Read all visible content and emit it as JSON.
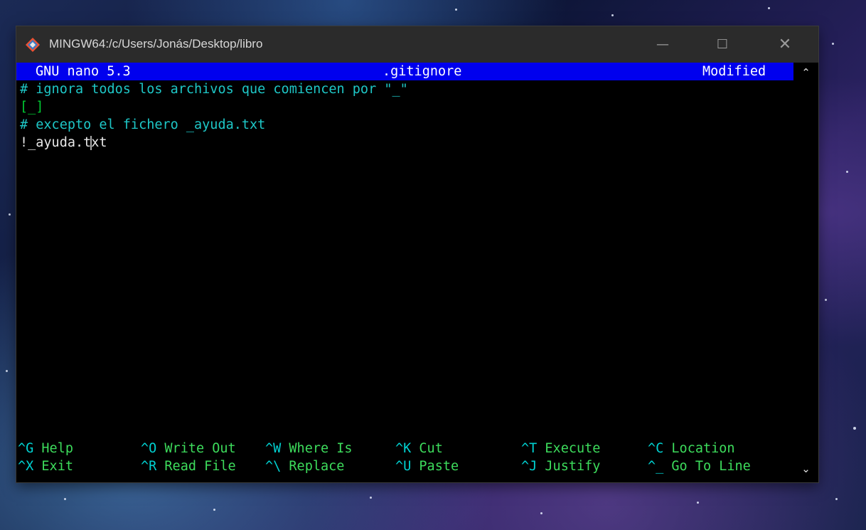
{
  "window": {
    "title": "MINGW64:/c/Users/Jonás/Desktop/libro",
    "minimize_icon": "—",
    "maximize_icon": "☐",
    "close_icon": "✕",
    "app_icon": "git-icon"
  },
  "nano": {
    "version": "GNU nano 5.3",
    "filename": ".gitignore",
    "status": "Modified"
  },
  "lines": [
    "# ignora todos los archivos que comiencen por \"_\"",
    "[_]",
    "# excepto el fichero _ayuda.txt",
    "!_ayuda.txt"
  ],
  "line4_before_cursor": "!_ayuda.t",
  "line4_after_cursor": "xt",
  "shortcuts": {
    "row1": [
      {
        "key": "^G",
        "label": "Help"
      },
      {
        "key": "^O",
        "label": "Write Out"
      },
      {
        "key": "^W",
        "label": "Where Is"
      },
      {
        "key": "^K",
        "label": "Cut"
      },
      {
        "key": "^T",
        "label": "Execute"
      },
      {
        "key": "^C",
        "label": "Location"
      }
    ],
    "row2": [
      {
        "key": "^X",
        "label": "Exit"
      },
      {
        "key": "^R",
        "label": "Read File"
      },
      {
        "key": "^\\",
        "label": "Replace"
      },
      {
        "key": "^U",
        "label": "Paste"
      },
      {
        "key": "^J",
        "label": "Justify"
      },
      {
        "key": "^_",
        "label": "Go To Line"
      }
    ]
  },
  "scrollbar": {
    "up_icon": "⌃",
    "down_icon": "⌄"
  },
  "colors": {
    "header_bg": "#0000ee",
    "comment": "#1ec7c7",
    "shortcut_key": "#00d1d1",
    "shortcut_label": "#3ddc5c"
  }
}
